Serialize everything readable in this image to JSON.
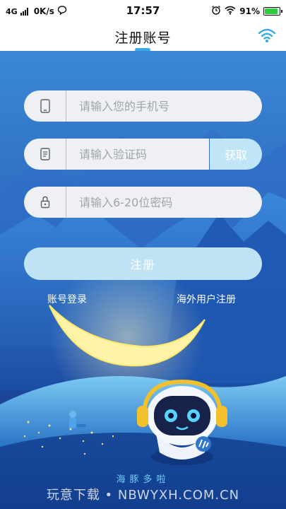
{
  "status_bar": {
    "network": "4G",
    "speed": "0K/s",
    "time": "17:57",
    "battery": "91%",
    "battery_level": 0.91,
    "icons": [
      "signal-icon",
      "chat-icon",
      "alarm-icon",
      "wifi-icon",
      "battery-icon"
    ]
  },
  "header": {
    "title": "注册账号",
    "icon": "wifi-icon",
    "accent_color": "#3aa8e8"
  },
  "form": {
    "phone": {
      "placeholder": "请输入您的手机号",
      "value": "",
      "icon": "phone-icon"
    },
    "code": {
      "placeholder": "请输入验证码",
      "value": "",
      "icon": "sms-icon",
      "button": "获取"
    },
    "password": {
      "placeholder": "请输入6-20位密码",
      "value": "",
      "icon": "lock-icon"
    },
    "submit": "注册"
  },
  "links": {
    "login": "账号登录",
    "overseas": "海外用户注册"
  },
  "brand": "海豚多啦",
  "watermark": "玩意下载 • NBWYXH.COM.CN"
}
